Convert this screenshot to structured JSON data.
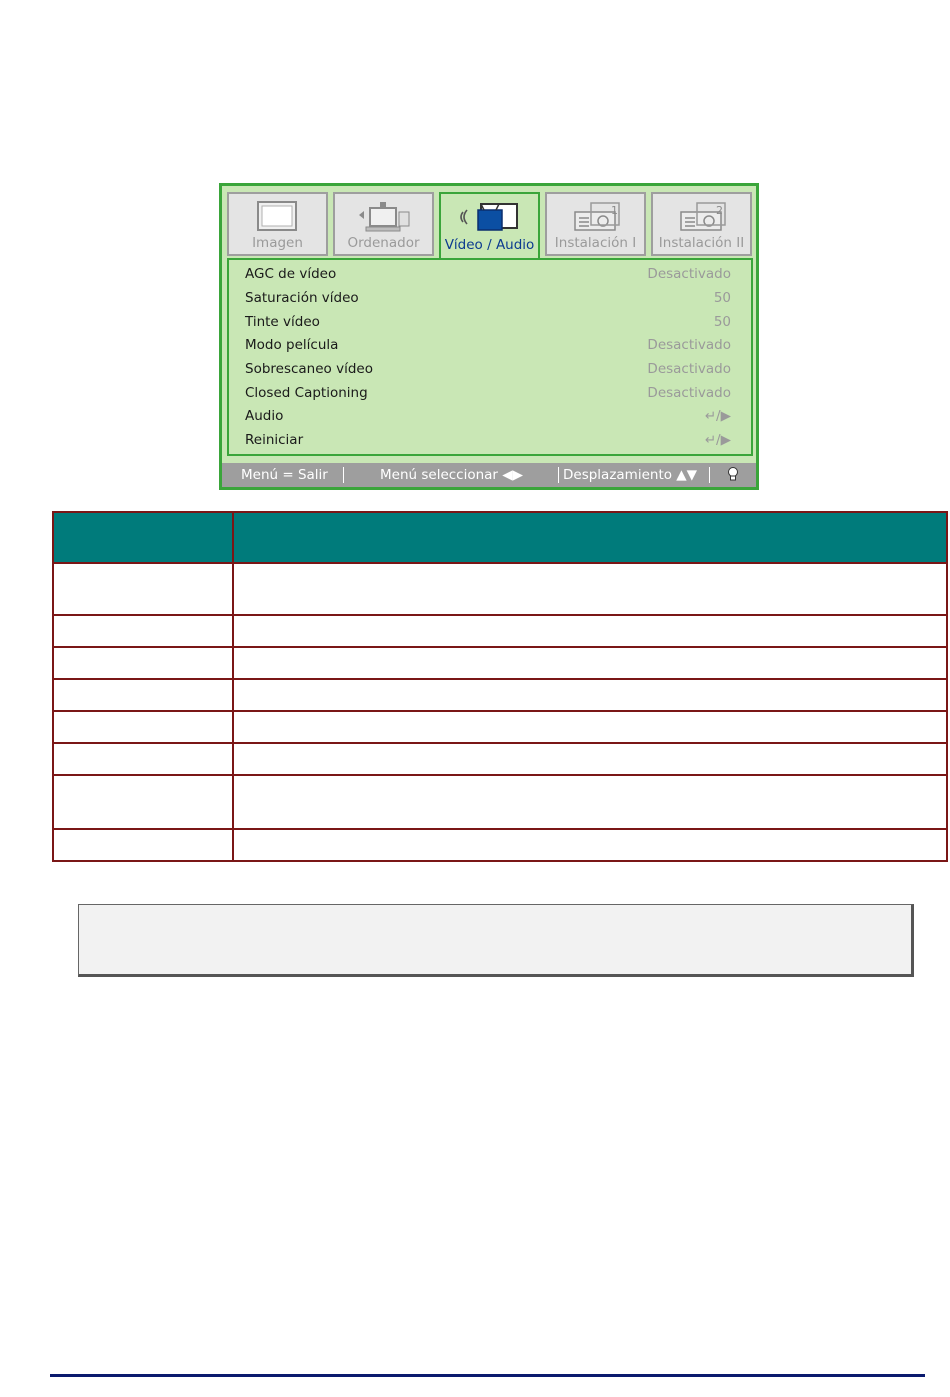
{
  "osd": {
    "tabs": [
      {
        "label": "Imagen",
        "icon": "monitor-icon",
        "active": false
      },
      {
        "label": "Ordenador",
        "icon": "computer-icon",
        "active": false
      },
      {
        "label": "Vídeo / Audio",
        "icon": "video-audio-icon",
        "active": true
      },
      {
        "label": "Instalación I",
        "icon": "projector-1-icon",
        "active": false
      },
      {
        "label": "Instalación II",
        "icon": "projector-2-icon",
        "active": false
      }
    ],
    "rows": [
      {
        "label": "AGC de vídeo",
        "value": "Desactivado"
      },
      {
        "label": "Saturación vídeo",
        "value": "50"
      },
      {
        "label": "Tinte vídeo",
        "value": "50"
      },
      {
        "label": "Modo película",
        "value": "Desactivado"
      },
      {
        "label": "Sobrescaneo vídeo",
        "value": "Desactivado"
      },
      {
        "label": "Closed Captioning",
        "value": "Desactivado"
      },
      {
        "label": "Audio",
        "value": "↵/▶"
      },
      {
        "label": "Reiniciar",
        "value": "↵/▶"
      }
    ],
    "footer": {
      "exit": "Menú = Salir",
      "select": "Menú seleccionar ◀▶",
      "scroll": "Desplazamiento ▲▼",
      "lamp_icon": "bulb-icon"
    },
    "colors": {
      "panel": "#c9e7b5",
      "border": "#3aa53a",
      "footer": "#9e9e9e",
      "active_text": "#0b3a8f"
    }
  },
  "table": {
    "header_color": "#007b7b",
    "border_color": "#7a1616"
  }
}
